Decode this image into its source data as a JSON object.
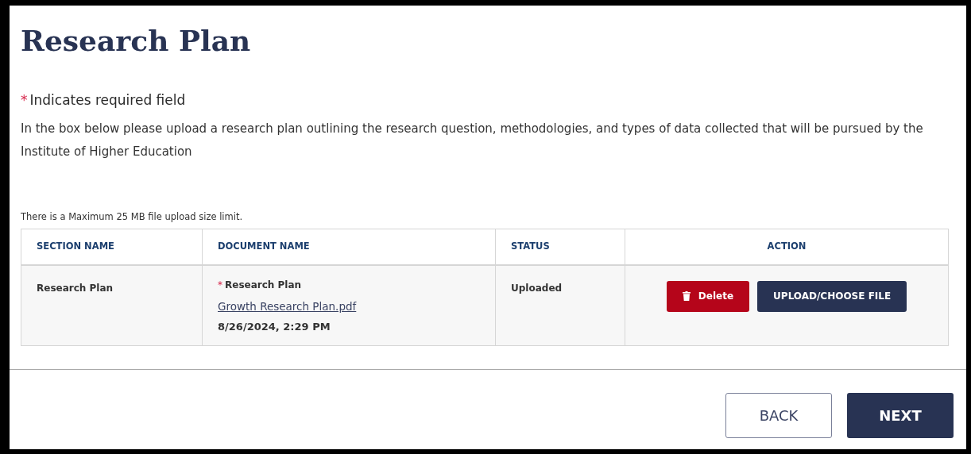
{
  "page": {
    "title": "Research Plan",
    "required_note": {
      "marker": "*",
      "text": "Indicates required field"
    },
    "instructions": "In the box below please upload a research plan outlining the research question, methodologies, and types of data collected that will be pursued by the Institute of Higher Education",
    "size_limit": "There is a Maximum 25 MB file upload size limit."
  },
  "table": {
    "columns": [
      "SECTION NAME",
      "DOCUMENT NAME",
      "STATUS",
      "ACTION"
    ],
    "rows": [
      {
        "section": "Research Plan",
        "document": {
          "required": true,
          "marker": "*",
          "name": "Research Plan",
          "file": "Growth Research Plan.pdf",
          "date": "8/26/2024, 2:29 PM"
        },
        "status": "Uploaded",
        "actions": [
          {
            "kind": "delete",
            "label": "Delete"
          },
          {
            "kind": "upload",
            "label": "UPLOAD/CHOOSE FILE"
          }
        ]
      }
    ]
  },
  "footer": {
    "buttons": [
      {
        "kind": "secondary",
        "label": "BACK"
      },
      {
        "kind": "primary",
        "label": "NEXT"
      }
    ]
  }
}
